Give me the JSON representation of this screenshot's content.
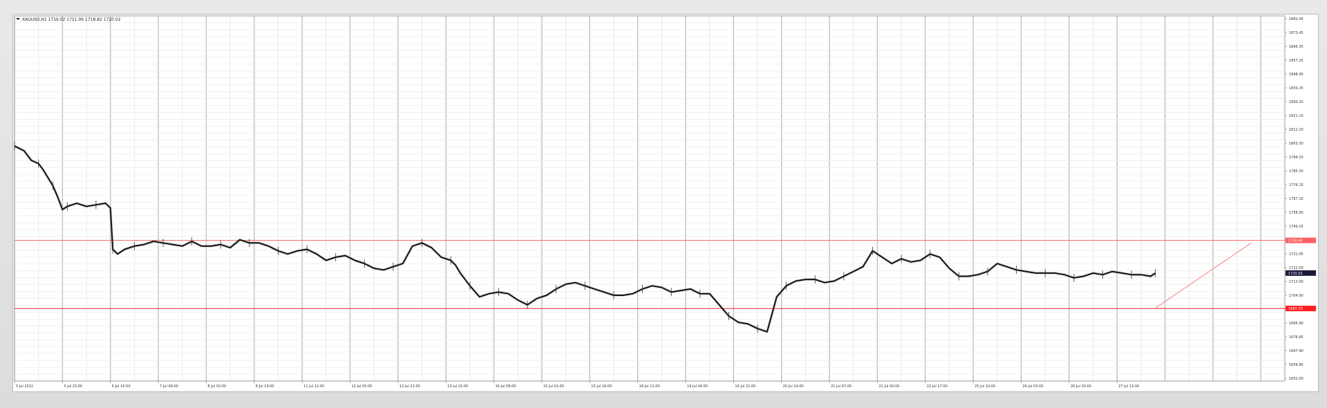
{
  "header": {
    "symbol_label": "XAUUSD,H1  1719.02  1721.06  1718.82  1720.02"
  },
  "chart_data": {
    "type": "line",
    "ylim": [
      1652,
      1882
    ],
    "grid": true,
    "y_ticks": [
      "1882.45",
      "1873.45",
      "1866.35",
      "1857.25",
      "1848.45",
      "1839.25",
      "1830.20",
      "1821.10",
      "1812.10",
      "1803.30",
      "1794.20",
      "1785.20",
      "1776.15",
      "1767.10",
      "1758.00",
      "1749.15",
      "1740.10",
      "1731.05",
      "1722.00",
      "1713.00",
      "1704.00",
      "1695.00",
      "1685.90",
      "1676.85",
      "1667.90",
      "1658.80",
      "1652.00"
    ],
    "x_ticks": [
      "5 Jul 2022",
      "5 Jul 23:00",
      "6 Jul 16:00",
      "7 Jul 09:00",
      "8 Jul 02:00",
      "8 Jul 19:00",
      "11 Jul 12:00",
      "12 Jul 05:00",
      "12 Jul 22:00",
      "13 Jul 15:00",
      "14 Jul 08:00",
      "15 Jul 01:00",
      "15 Jul 18:00",
      "18 Jul 11:00",
      "19 Jul 04:00",
      "19 Jul 21:00",
      "20 Jul 14:00",
      "21 Jul 07:00",
      "22 Jul 00:00",
      "22 Jul 17:00",
      "25 Jul 10:00",
      "26 Jul 03:00",
      "26 Jul 20:00",
      "27 Jul 13:00"
    ],
    "x_label_positions": [
      0,
      1,
      2,
      3,
      4,
      5,
      6,
      7,
      8,
      9,
      10,
      11,
      12,
      13,
      14,
      15,
      16,
      17,
      18,
      19,
      20,
      21,
      22,
      23
    ],
    "horizontal_lines": [
      {
        "value": 1740.6,
        "label": "1740.60",
        "color": "#ff6060"
      },
      {
        "value": 1697.7,
        "label": "1697.70",
        "color": "#ff2020"
      }
    ],
    "current_price": {
      "value": 1720.02,
      "label": "1720.02",
      "color": "#1a1a3a"
    },
    "trend_line": {
      "x": [
        23.8,
        25.8
      ],
      "y": [
        1698,
        1739
      ],
      "color": "#ff9090"
    },
    "series": [
      {
        "x": [
          0,
          0.2,
          0.35,
          0.5,
          0.6,
          0.7,
          0.8,
          0.9,
          1.0,
          1.1,
          1.3,
          1.5,
          1.7,
          1.9,
          2.0,
          2.05,
          2.15,
          2.3,
          2.5,
          2.7,
          2.9,
          3.1,
          3.3,
          3.5,
          3.7,
          3.9,
          4.1,
          4.3,
          4.5,
          4.7,
          4.9,
          5.1,
          5.3,
          5.5,
          5.7,
          5.9,
          6.1,
          6.3,
          6.5,
          6.7,
          6.9,
          7.1,
          7.3,
          7.5,
          7.7,
          7.9,
          8.1,
          8.3,
          8.5,
          8.7,
          8.9,
          9.1,
          9.2,
          9.3,
          9.5,
          9.7,
          9.9,
          10.1,
          10.3,
          10.5,
          10.7,
          10.9,
          11.1,
          11.3,
          11.5,
          11.7,
          11.9,
          12.1,
          12.3,
          12.5,
          12.7,
          12.9,
          13.1,
          13.3,
          13.5,
          13.7,
          13.9,
          14.1,
          14.3,
          14.5,
          14.7,
          14.9,
          15.1,
          15.3,
          15.5,
          15.7,
          15.9,
          16.1,
          16.3,
          16.5,
          16.7,
          16.9,
          17.1,
          17.3,
          17.5,
          17.7,
          17.9,
          18.1,
          18.3,
          18.5,
          18.7,
          18.9,
          19.1,
          19.3,
          19.5,
          19.7,
          19.9,
          20.1,
          20.3,
          20.5,
          20.7,
          20.9,
          21.1,
          21.3,
          21.5,
          21.7,
          21.9,
          22.1,
          22.3,
          22.5,
          22.7,
          22.9,
          23.1,
          23.3,
          23.5,
          23.7,
          23.8
        ],
        "y": [
          1800,
          1797,
          1791,
          1789,
          1785,
          1780,
          1775,
          1768,
          1760,
          1762,
          1764,
          1762,
          1763,
          1764,
          1761,
          1735,
          1732,
          1735,
          1737,
          1738,
          1740,
          1739,
          1738,
          1737,
          1740,
          1737,
          1737,
          1738,
          1736,
          1741,
          1739,
          1739,
          1737,
          1734,
          1732,
          1734,
          1735,
          1732,
          1728,
          1730,
          1731,
          1728,
          1726,
          1723,
          1722,
          1724,
          1726,
          1737,
          1739,
          1736,
          1730,
          1728,
          1725,
          1720,
          1712,
          1705,
          1707,
          1708,
          1707,
          1703,
          1700,
          1704,
          1706,
          1710,
          1713,
          1714,
          1712,
          1710,
          1708,
          1706,
          1706,
          1707,
          1710,
          1712,
          1711,
          1708,
          1709,
          1710,
          1707,
          1707,
          1700,
          1693,
          1689,
          1688,
          1685,
          1683,
          1705,
          1712,
          1715,
          1716,
          1716,
          1714,
          1715,
          1718,
          1721,
          1724,
          1734,
          1730,
          1726,
          1729,
          1727,
          1728,
          1732,
          1730,
          1723,
          1718,
          1718,
          1719,
          1721,
          1726,
          1724,
          1722,
          1721,
          1720,
          1720,
          1720,
          1719,
          1717,
          1718,
          1720,
          1719,
          1721,
          1720,
          1719,
          1719,
          1718,
          1720
        ]
      }
    ]
  }
}
